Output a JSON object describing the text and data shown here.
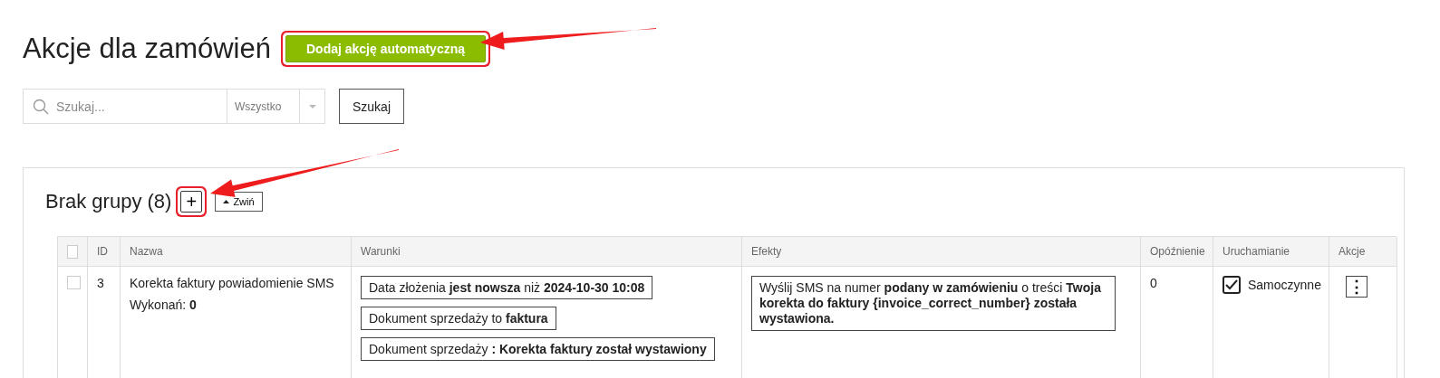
{
  "page_title": "Akcje dla zamówień",
  "add_button": {
    "label": "Dodaj akcję automatyczną",
    "highlighted": true
  },
  "search": {
    "placeholder": "Szukaj...",
    "filter": "Wszystko",
    "button": "Szukaj"
  },
  "group": {
    "title": "Brak grupy (8)",
    "add_button": {
      "label": "+",
      "highlighted": true
    },
    "collapse_button": {
      "label": "Zwiń",
      "expanded": true
    },
    "table": {
      "columns": [
        "ID",
        "Nazwa",
        "Warunki",
        "Efekty",
        "Opóźnienie",
        "Uruchamianie",
        "Akcje"
      ],
      "all_checked": false,
      "rows": [
        {
          "selected": false,
          "id": "3",
          "name": "Korekta faktury powiadomienie SMS",
          "runs": "Wykonań: **0**",
          "conditions": [
            "Data złożenia **jest nowsza** niż **2024-10-30 10:08**",
            "Dokument sprzedaży to **faktura**",
            "Dokument sprzedaży **: Korekta faktury został wystawiony**"
          ],
          "effects": [
            "Wyślij SMS na numer **podany w zamówieniu** o treści **Twoja korekta do faktury {invoice_correct_number} została wystawiona.**"
          ],
          "delay": "0",
          "trigger": {
            "label": "Samoczynne",
            "checked": true
          },
          "actions": "⋮"
        }
      ]
    }
  },
  "annotations": [
    {
      "kind": "arrow"
    },
    {
      "kind": "arrow"
    }
  ]
}
